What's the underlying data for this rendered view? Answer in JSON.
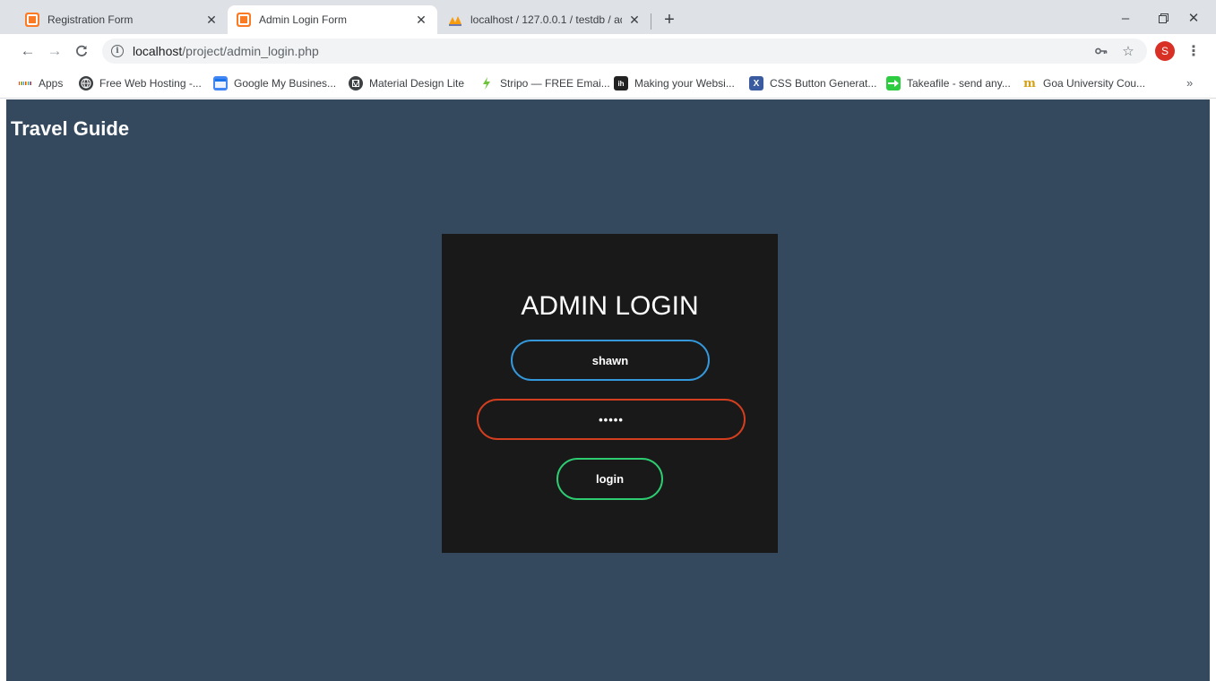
{
  "browser": {
    "tabs": [
      {
        "title": "Registration Form",
        "favicon": "xampp-icon",
        "active": false
      },
      {
        "title": "Admin Login Form",
        "favicon": "xampp-icon",
        "active": true
      },
      {
        "title": "localhost / 127.0.0.1 / testdb / ad",
        "favicon": "phpmyadmin-icon",
        "active": false
      }
    ],
    "url_host": "localhost",
    "url_path": "/project/admin_login.php",
    "profile_initial": "S",
    "bookmarks": [
      {
        "label": "Apps",
        "icon": "apps-grid-icon"
      },
      {
        "label": "Free Web Hosting -...",
        "icon": "globe-icon"
      },
      {
        "label": "Google My Busines...",
        "icon": "google-my-business-icon"
      },
      {
        "label": "Material Design Lite",
        "icon": "material-design-icon"
      },
      {
        "label": "Stripo — FREE Emai...",
        "icon": "stripo-icon"
      },
      {
        "label": "Making your Websi...",
        "icon": "ih-icon"
      },
      {
        "label": "CSS Button Generat...",
        "icon": "css-x-icon"
      },
      {
        "label": "Takeafile - send any...",
        "icon": "takeafile-icon"
      },
      {
        "label": "Goa University Cou...",
        "icon": "goa-university-icon"
      }
    ]
  },
  "page": {
    "site_title": "Travel Guide",
    "login": {
      "heading": "ADMIN LOGIN",
      "username_value": "shawn",
      "password_value": "•••••",
      "submit_label": "login"
    }
  },
  "colors": {
    "page_background": "#34495e",
    "box_background": "#191919",
    "username_border": "#3498db",
    "password_border": "#d33e1f",
    "button_border": "#2ecc71"
  }
}
